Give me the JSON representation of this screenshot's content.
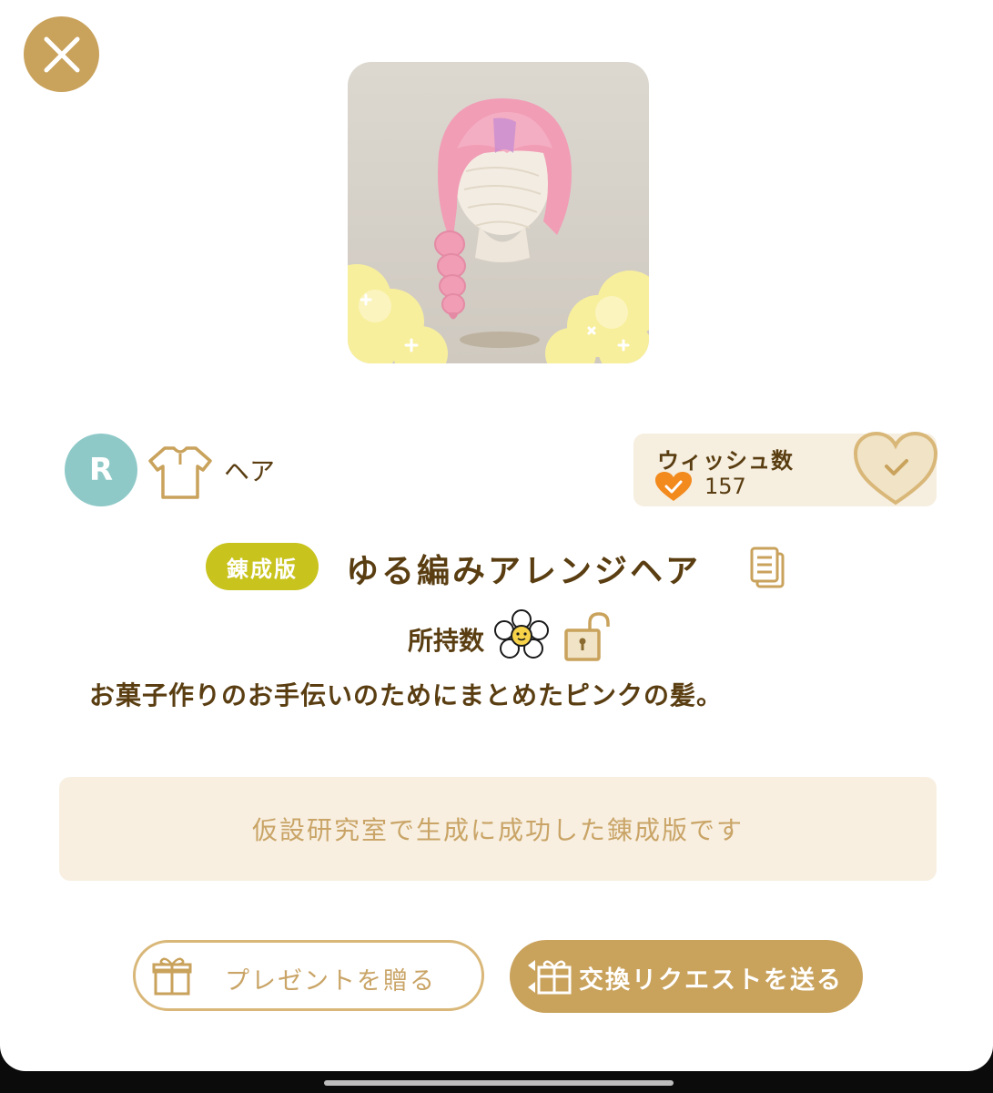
{
  "close_button": {
    "icon": "close-icon"
  },
  "item": {
    "rarity": "R",
    "category": "ヘア",
    "category_icon": "shirt-icon",
    "edition_badge": "錬成版",
    "name": "ゆる編みアレンジヘア",
    "owned_label": "所持数",
    "description": "お菓子作りのお手伝いのためにまとめたピンクの髪。",
    "info": "仮設研究室で生成に成功した錬成版です"
  },
  "wish": {
    "title": "ウィッシュ数",
    "count": "157"
  },
  "buttons": {
    "present": "プレゼントを贈る",
    "trade": "交換リクエストを送る"
  },
  "colors": {
    "gold": "#c9a25c",
    "brown_text": "#5a3e12",
    "rarity_teal": "#8ec9c8",
    "edition_yellow": "#c8c31d",
    "info_bg": "#f8efe1",
    "wish_bg": "#f6eedf",
    "heart_orange": "#f28a1e"
  }
}
